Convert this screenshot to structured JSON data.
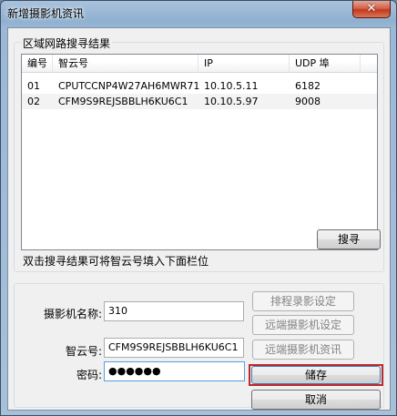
{
  "window": {
    "title": "新增摄影机资讯",
    "close_glyph": "✕"
  },
  "search_group": {
    "label": "区域网路搜寻结果",
    "columns": [
      "编号",
      "智云号",
      "IP",
      "UDP 埠"
    ],
    "rows": [
      {
        "id": "01",
        "cloud_id": "CPUTCCNP4W27AH6MWR71",
        "ip": "10.10.5.11",
        "udp": "6182"
      },
      {
        "id": "02",
        "cloud_id": "CFM9S9REJSBBLH6KU6C1",
        "ip": "10.10.5.97",
        "udp": "9008"
      }
    ],
    "search_button": "搜寻",
    "hint": "双击搜寻结果可将智云号填入下面栏位"
  },
  "form": {
    "name_label": "摄影机名称:",
    "name_value": "310",
    "cloud_label": "智云号:",
    "cloud_value": "CFM9S9REJSBBLH6KU6C1",
    "password_label": "密码:",
    "password_value": "●●●●●●"
  },
  "buttons": {
    "schedule": "排程录影设定",
    "remote_settings": "远端摄影机设定",
    "remote_info": "远端摄影机资讯",
    "save": "储存",
    "cancel": "取消"
  }
}
